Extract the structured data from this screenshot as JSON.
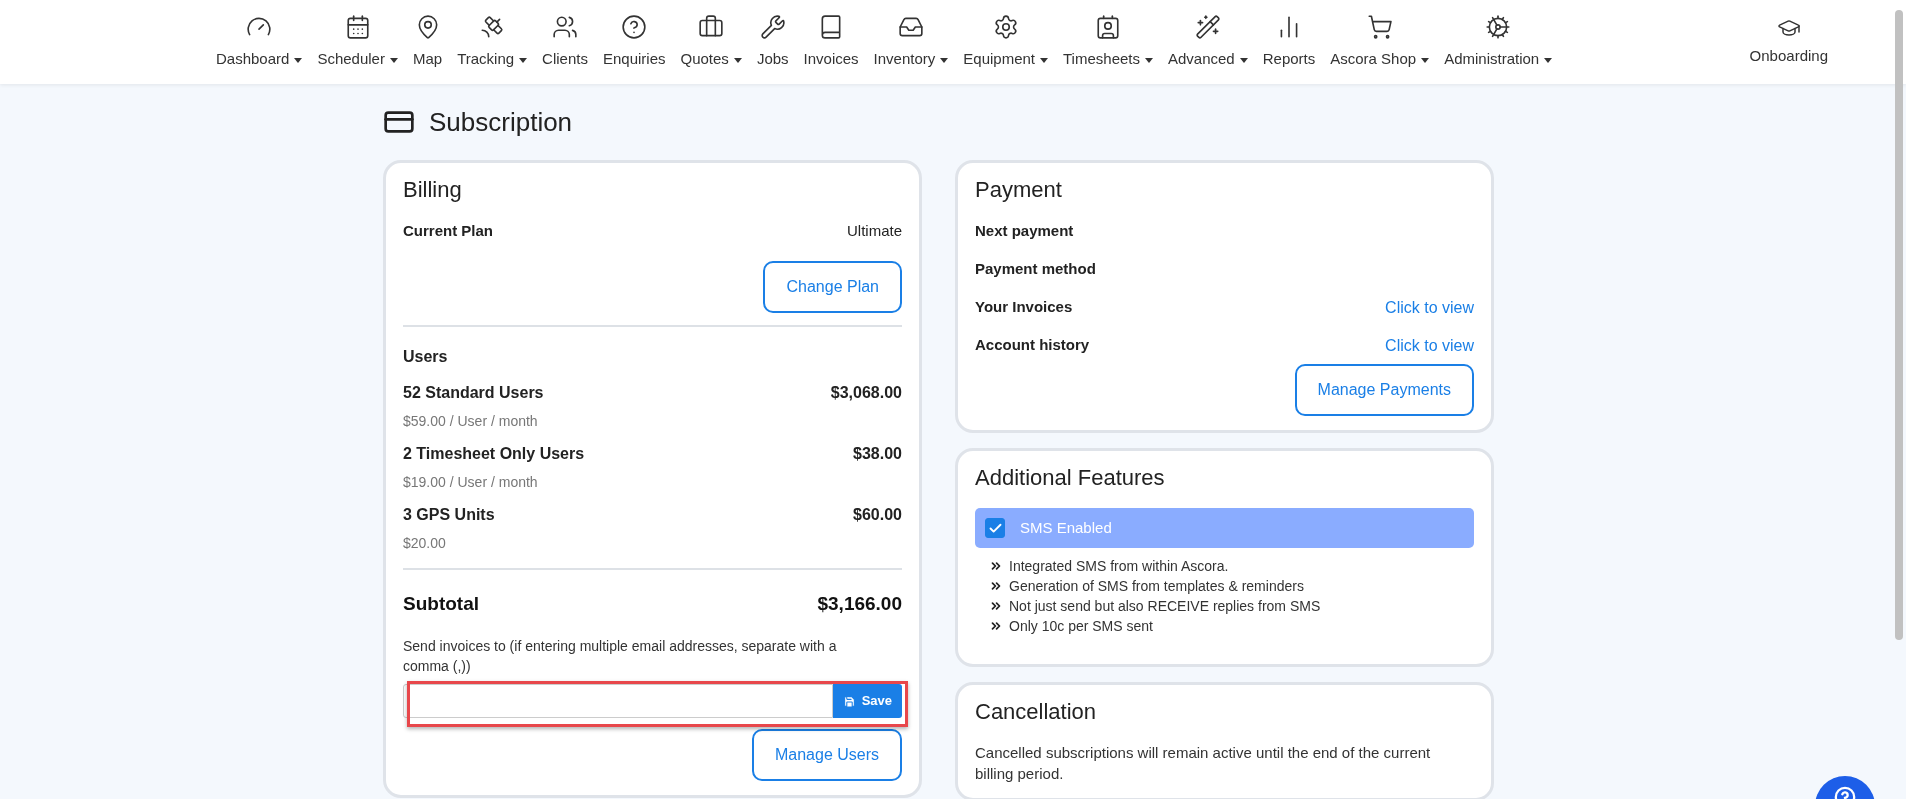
{
  "nav": {
    "items": [
      {
        "label": "Dashboard",
        "dropdown": true
      },
      {
        "label": "Scheduler",
        "dropdown": true
      },
      {
        "label": "Map",
        "dropdown": false
      },
      {
        "label": "Tracking",
        "dropdown": true
      },
      {
        "label": "Clients",
        "dropdown": false
      },
      {
        "label": "Enquiries",
        "dropdown": false
      },
      {
        "label": "Quotes",
        "dropdown": true
      },
      {
        "label": "Jobs",
        "dropdown": false
      },
      {
        "label": "Invoices",
        "dropdown": false
      },
      {
        "label": "Inventory",
        "dropdown": true
      },
      {
        "label": "Equipment",
        "dropdown": true
      },
      {
        "label": "Timesheets",
        "dropdown": true
      },
      {
        "label": "Advanced",
        "dropdown": true
      },
      {
        "label": "Reports",
        "dropdown": false
      },
      {
        "label": "Ascora Shop",
        "dropdown": true
      },
      {
        "label": "Administration",
        "dropdown": true
      }
    ],
    "right_item": {
      "label": "Onboarding"
    }
  },
  "page_title": "Subscription",
  "billing": {
    "title": "Billing",
    "current_plan_label": "Current Plan",
    "current_plan": "Ultimate",
    "change_plan_button": "Change Plan",
    "users_heading": "Users",
    "lines": [
      {
        "name": "52 Standard Users",
        "price": "$3,068.00",
        "detail": "$59.00 / User / month"
      },
      {
        "name": "2 Timesheet Only Users",
        "price": "$38.00",
        "detail": "$19.00 / User / month"
      },
      {
        "name": "3 GPS Units",
        "price": "$60.00",
        "detail": "$20.00"
      }
    ],
    "subtotal_label": "Subtotal",
    "subtotal": "$3,166.00",
    "invoice_email_label": "Send invoices to (if entering multiple email addresses, separate with a comma (,))",
    "save_button": "Save",
    "manage_users_button": "Manage Users"
  },
  "payment": {
    "title": "Payment",
    "rows": [
      {
        "label": "Next payment"
      },
      {
        "label": "Payment method"
      },
      {
        "label": "Your Invoices",
        "link": "Click to view"
      },
      {
        "label": "Account history",
        "link": "Click to view"
      }
    ],
    "manage_payments_button": "Manage Payments"
  },
  "additional_features": {
    "title": "Additional Features",
    "features": [
      {
        "label": "SMS Enabled",
        "checked": true,
        "bullets": [
          "Integrated SMS from within Ascora.",
          "Generation of SMS from templates & reminders",
          "Not just send but also RECEIVE replies from SMS",
          "Only 10c per SMS sent"
        ]
      }
    ]
  },
  "cancellation": {
    "title": "Cancellation",
    "text": "Cancelled subscriptions will remain active until the end of the current billing period."
  }
}
